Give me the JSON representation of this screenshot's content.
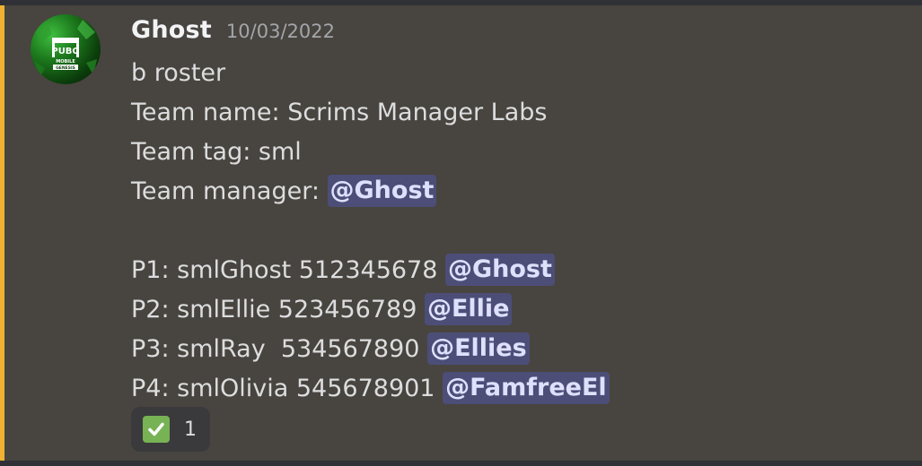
{
  "message": {
    "author": "Ghost",
    "timestamp": "10/03/2022",
    "avatar": {
      "icon": "pubg-mobile-logo-icon",
      "brand_line1": "PUBG",
      "brand_line2": "MOBILE",
      "brand_line3": "GENESIS"
    },
    "lines": [
      {
        "text": "b roster",
        "mention": ""
      },
      {
        "text": "Team name: Scrims Manager Labs",
        "mention": ""
      },
      {
        "text": "Team tag: sml",
        "mention": ""
      },
      {
        "text": "Team manager: ",
        "mention": "@Ghost"
      },
      {
        "text": "",
        "mention": ""
      },
      {
        "text": "P1: smlGhost 512345678 ",
        "mention": "@Ghost"
      },
      {
        "text": "P2: smlEllie 523456789 ",
        "mention": "@Ellie"
      },
      {
        "text": "P3: smlRay  534567890 ",
        "mention": "@Ellies"
      },
      {
        "text": "P4: smlOlivia 545678901 ",
        "mention": "@FamfreeEl"
      }
    ],
    "reaction": {
      "emoji": "white-check-mark-icon",
      "count": "1"
    }
  },
  "colors": {
    "background": "#48443f",
    "highlight_bar": "#f0b232",
    "mention_bg": "#4d4f7a",
    "mention_text": "#dee0fc",
    "check_green": "#77b255"
  }
}
